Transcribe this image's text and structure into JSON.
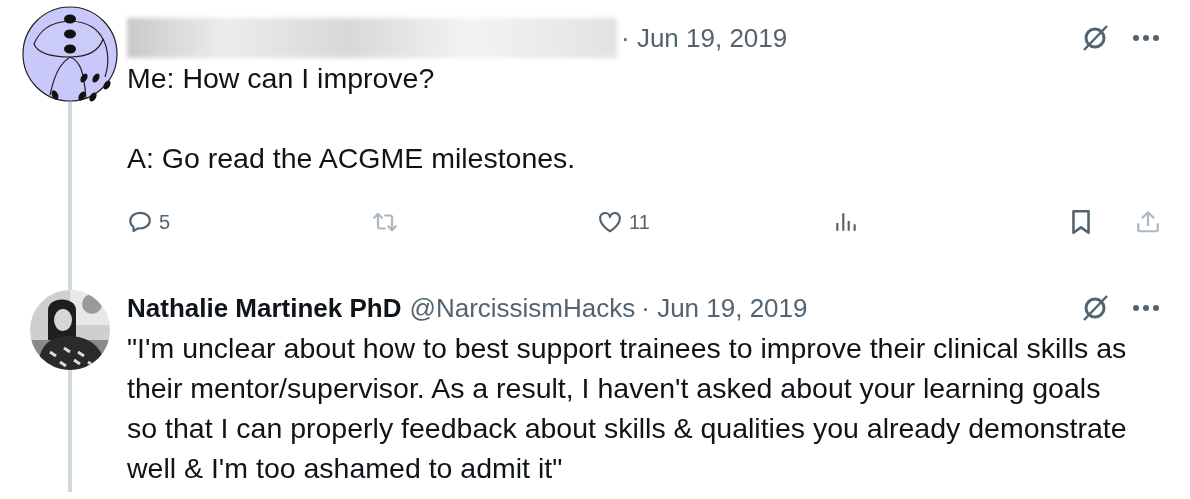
{
  "tweets": [
    {
      "avatar": {
        "kind": "dice"
      },
      "date": "· Jun 19, 2019",
      "text": "Me: How can I improve?\n\nA: Go read the ACGME milestones.",
      "actions": [
        {
          "kind": "reply",
          "count": "5",
          "disabled": false
        },
        {
          "kind": "retweet",
          "disabled": true
        },
        {
          "kind": "like",
          "count": "11",
          "disabled": false
        },
        {
          "kind": "views",
          "disabled": false
        },
        {
          "kind": "bookmark",
          "disabled": false
        },
        {
          "kind": "share",
          "disabled": true
        }
      ]
    },
    {
      "display_name": "Nathalie Martinek PhD",
      "handle": "@NarcissismHacks",
      "date": "· Jun 19, 2019",
      "text": "\"I'm unclear about how to best support trainees to improve their clinical skills as their mentor/supervisor. As a result, I haven't asked about your learning goals so that I can properly feedback about skills & qualities you already demonstrate well & I'm too ashamed to admit it\""
    }
  ]
}
